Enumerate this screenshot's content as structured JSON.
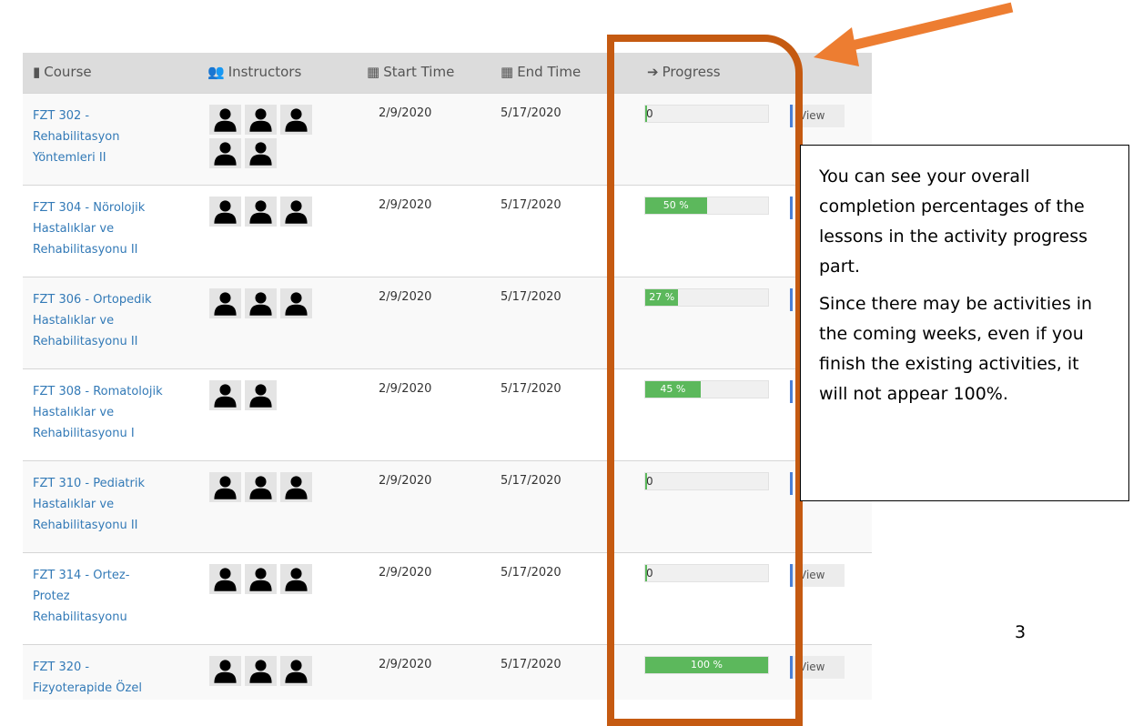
{
  "header": {
    "course": "Course",
    "instructors": "Instructors",
    "start_time": "Start Time",
    "end_time": "End Time",
    "progress": "Progress"
  },
  "icons": {
    "course": "book-icon",
    "instructors": "users-icon",
    "start_time": "calendar-icon",
    "end_time": "calendar-icon",
    "progress": "arrow-right-icon",
    "instructor_avatar": "user-silhouette-icon"
  },
  "rows": [
    {
      "course_lines": [
        "FZT 302 -",
        "Rehabilitasyon",
        "Yöntemleri II"
      ],
      "instructor_count": 5,
      "start": "2/9/2020",
      "end": "5/17/2020",
      "progress": 0,
      "progress_label": "0",
      "view": "View"
    },
    {
      "course_lines": [
        "FZT 304 - Nörolojik",
        "Hastalıklar ve",
        "Rehabilitasyonu II"
      ],
      "instructor_count": 3,
      "start": "2/9/2020",
      "end": "5/17/2020",
      "progress": 50,
      "progress_label": "50 %",
      "view": ""
    },
    {
      "course_lines": [
        "FZT 306 - Ortopedik",
        "Hastalıklar ve",
        "Rehabilitasyonu II"
      ],
      "instructor_count": 3,
      "start": "2/9/2020",
      "end": "5/17/2020",
      "progress": 27,
      "progress_label": "27 %",
      "view": ""
    },
    {
      "course_lines": [
        "FZT 308 - Romatolojik",
        "Hastalıklar ve",
        "Rehabilitasyonu I"
      ],
      "instructor_count": 2,
      "start": "2/9/2020",
      "end": "5/17/2020",
      "progress": 45,
      "progress_label": "45 %",
      "view": ""
    },
    {
      "course_lines": [
        "FZT 310 - Pediatrik",
        "Hastalıklar ve",
        "Rehabilitasyonu II"
      ],
      "instructor_count": 3,
      "start": "2/9/2020",
      "end": "5/17/2020",
      "progress": 0,
      "progress_label": "0",
      "view": ""
    },
    {
      "course_lines": [
        "FZT 314 - Ortez-",
        "Protez",
        "Rehabilitasyonu"
      ],
      "instructor_count": 3,
      "start": "2/9/2020",
      "end": "5/17/2020",
      "progress": 0,
      "progress_label": "0",
      "view": "View"
    },
    {
      "course_lines": [
        "FZT 320 -",
        "Fizyoterapide Özel"
      ],
      "instructor_count": 3,
      "start": "2/9/2020",
      "end": "5/17/2020",
      "progress": 100,
      "progress_label": "100 %",
      "view": "View"
    }
  ],
  "callout": {
    "p1": "You can see your overall completion percentages of the lessons in the activity progress part.",
    "p2": "Since there may be activities in the coming weeks, even if you finish the existing activities, it will not appear 100%."
  },
  "annotation_colors": {
    "highlight": "#c55a11",
    "arrow": "#ed7d31",
    "progress_fill": "#5cb85c",
    "link": "#337ab7"
  },
  "page_number": "3"
}
